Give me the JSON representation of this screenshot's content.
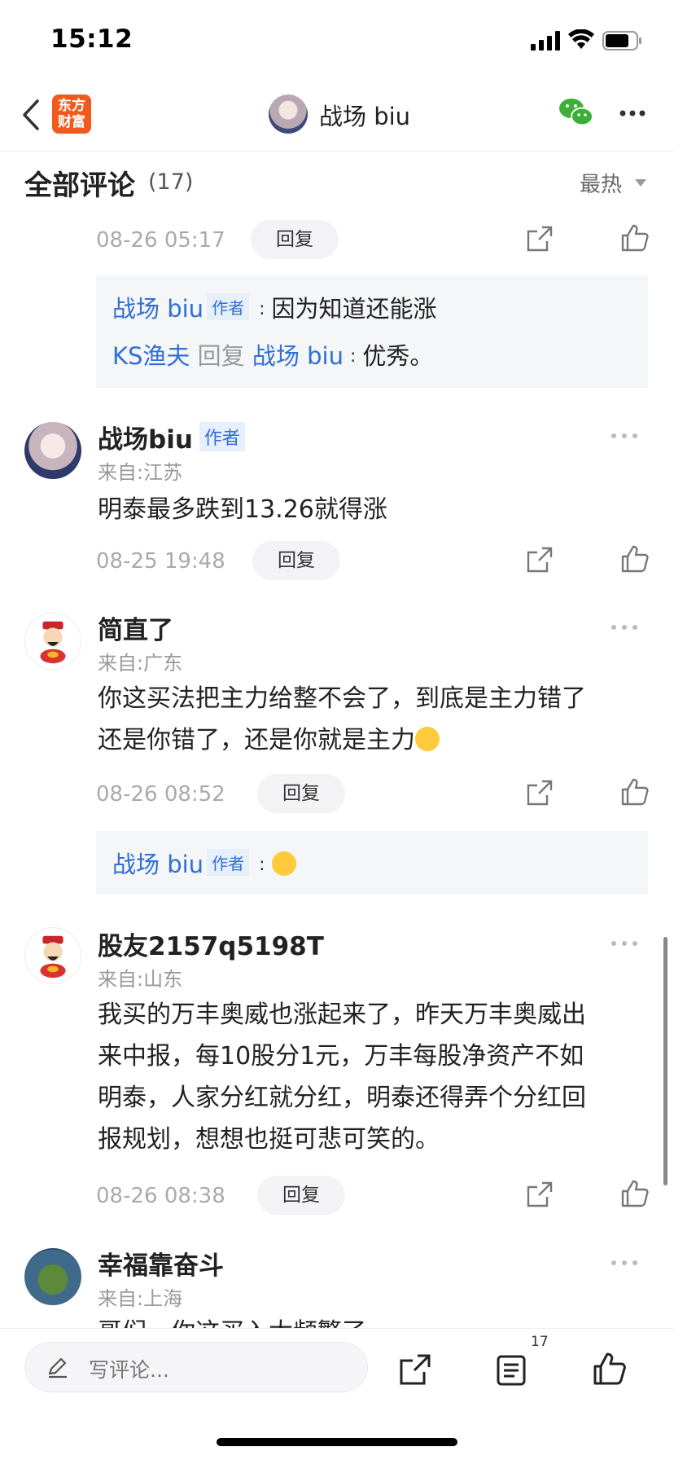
{
  "status_bar": {
    "time": "15:12"
  },
  "nav": {
    "logo_text_1": "东方",
    "logo_text_2": "财富",
    "title": "战场 biu"
  },
  "section": {
    "title": "全部评论",
    "count": "(17)",
    "sort_label": "最热"
  },
  "common": {
    "reply_label": "回复",
    "author_tag": "作者"
  },
  "top_comment": {
    "time": "08-26 05:17",
    "replies": [
      {
        "from": "战场 biu",
        "is_author": true,
        "text": "因为知道还能涨"
      },
      {
        "from": "KS渔夫",
        "reply_word": "回复",
        "to": "战场 biu",
        "text": "优秀。"
      }
    ]
  },
  "comments": [
    {
      "name": "战场biu",
      "is_author": true,
      "location": "来自:江苏",
      "text": "明泰最多跌到13.26就得涨",
      "time": "08-25 19:48"
    },
    {
      "name": "简直了",
      "location": "来自:广东",
      "text_line1": "你这买法把主力给整不会了，到底是主力错了",
      "text_line2": "还是你错了，还是你就是主力",
      "time": "08-26 08:52",
      "reply": {
        "from": "战场 biu",
        "is_author": true
      }
    },
    {
      "name": "股友2157q5198T",
      "location": "来自:山东",
      "lines": [
        "我买的万丰奥威也涨起来了，昨天万丰奥威出",
        "来中报，每10股分1元，万丰每股净资产不如",
        "明泰，人家分红就分红，明泰还得弄个分红回",
        "报规划，想想也挺可悲可笑的。"
      ],
      "time": "08-26 08:38"
    },
    {
      "name": "幸福靠奋斗",
      "location": "来自:上海",
      "partial_text": "哥们，你这买入太频繁了"
    }
  ],
  "bottom_bar": {
    "input_placeholder": "写评论...",
    "comment_count": "17"
  },
  "colors": {
    "link_blue": "#2f6fd6",
    "brand_orange": "#f15a1f",
    "wechat_green": "#3cb034"
  }
}
